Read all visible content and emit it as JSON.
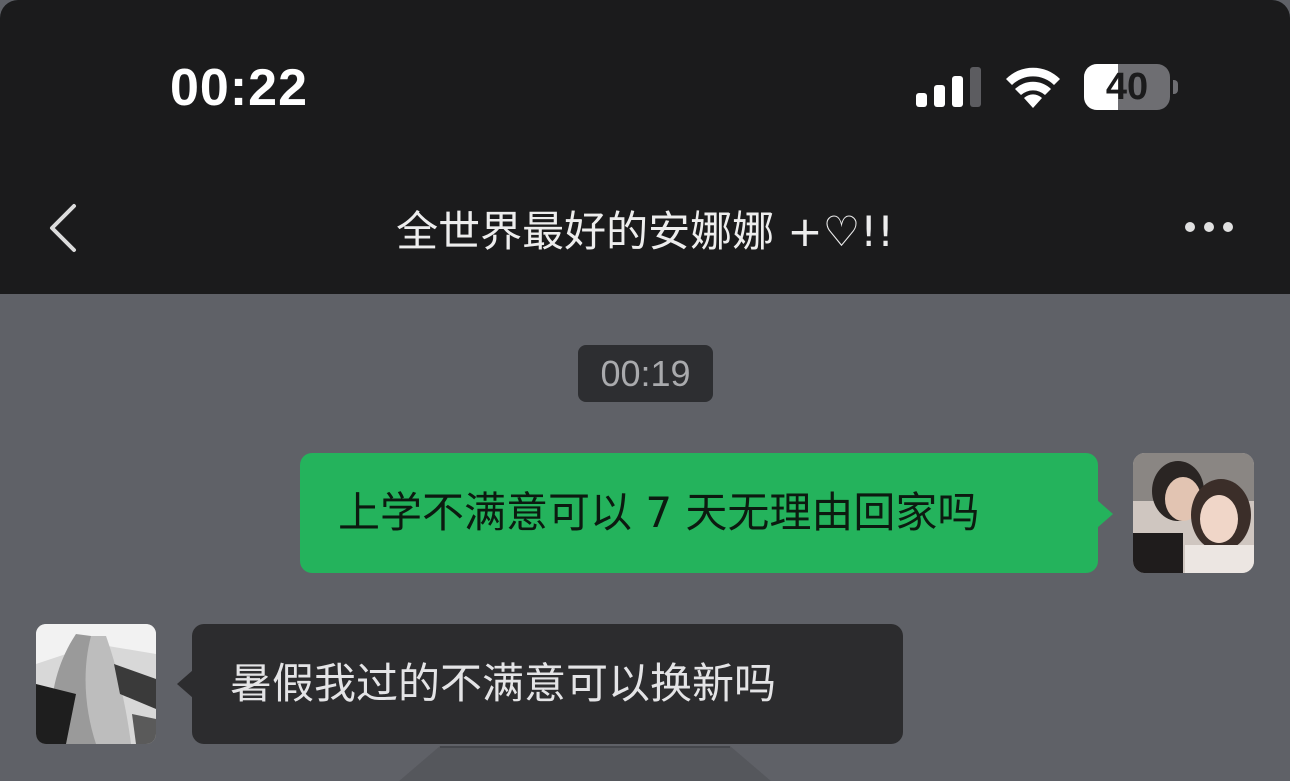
{
  "status_bar": {
    "time": "00:22",
    "battery_level": "40",
    "battery_fraction": 0.4,
    "signal_icon": "cellular-signal-icon",
    "wifi_icon": "wifi-icon"
  },
  "nav": {
    "back_icon": "chevron-left-icon",
    "title": "全世界最好的安娜娜 +♡!!",
    "more_icon": "more-dots-icon"
  },
  "chat": {
    "timestamp": "00:19",
    "messages": [
      {
        "direction": "outgoing",
        "text": "上学不满意可以 7 天无理由回家吗"
      },
      {
        "direction": "incoming",
        "text": "暑假我过的不满意可以换新吗"
      }
    ]
  },
  "colors": {
    "header_bg": "#1b1b1c",
    "chat_bg": "#5f6167",
    "outgoing_bubble": "#24b35c",
    "incoming_bubble": "#2c2c2e",
    "timestamp_bg": "#2d2e31"
  }
}
